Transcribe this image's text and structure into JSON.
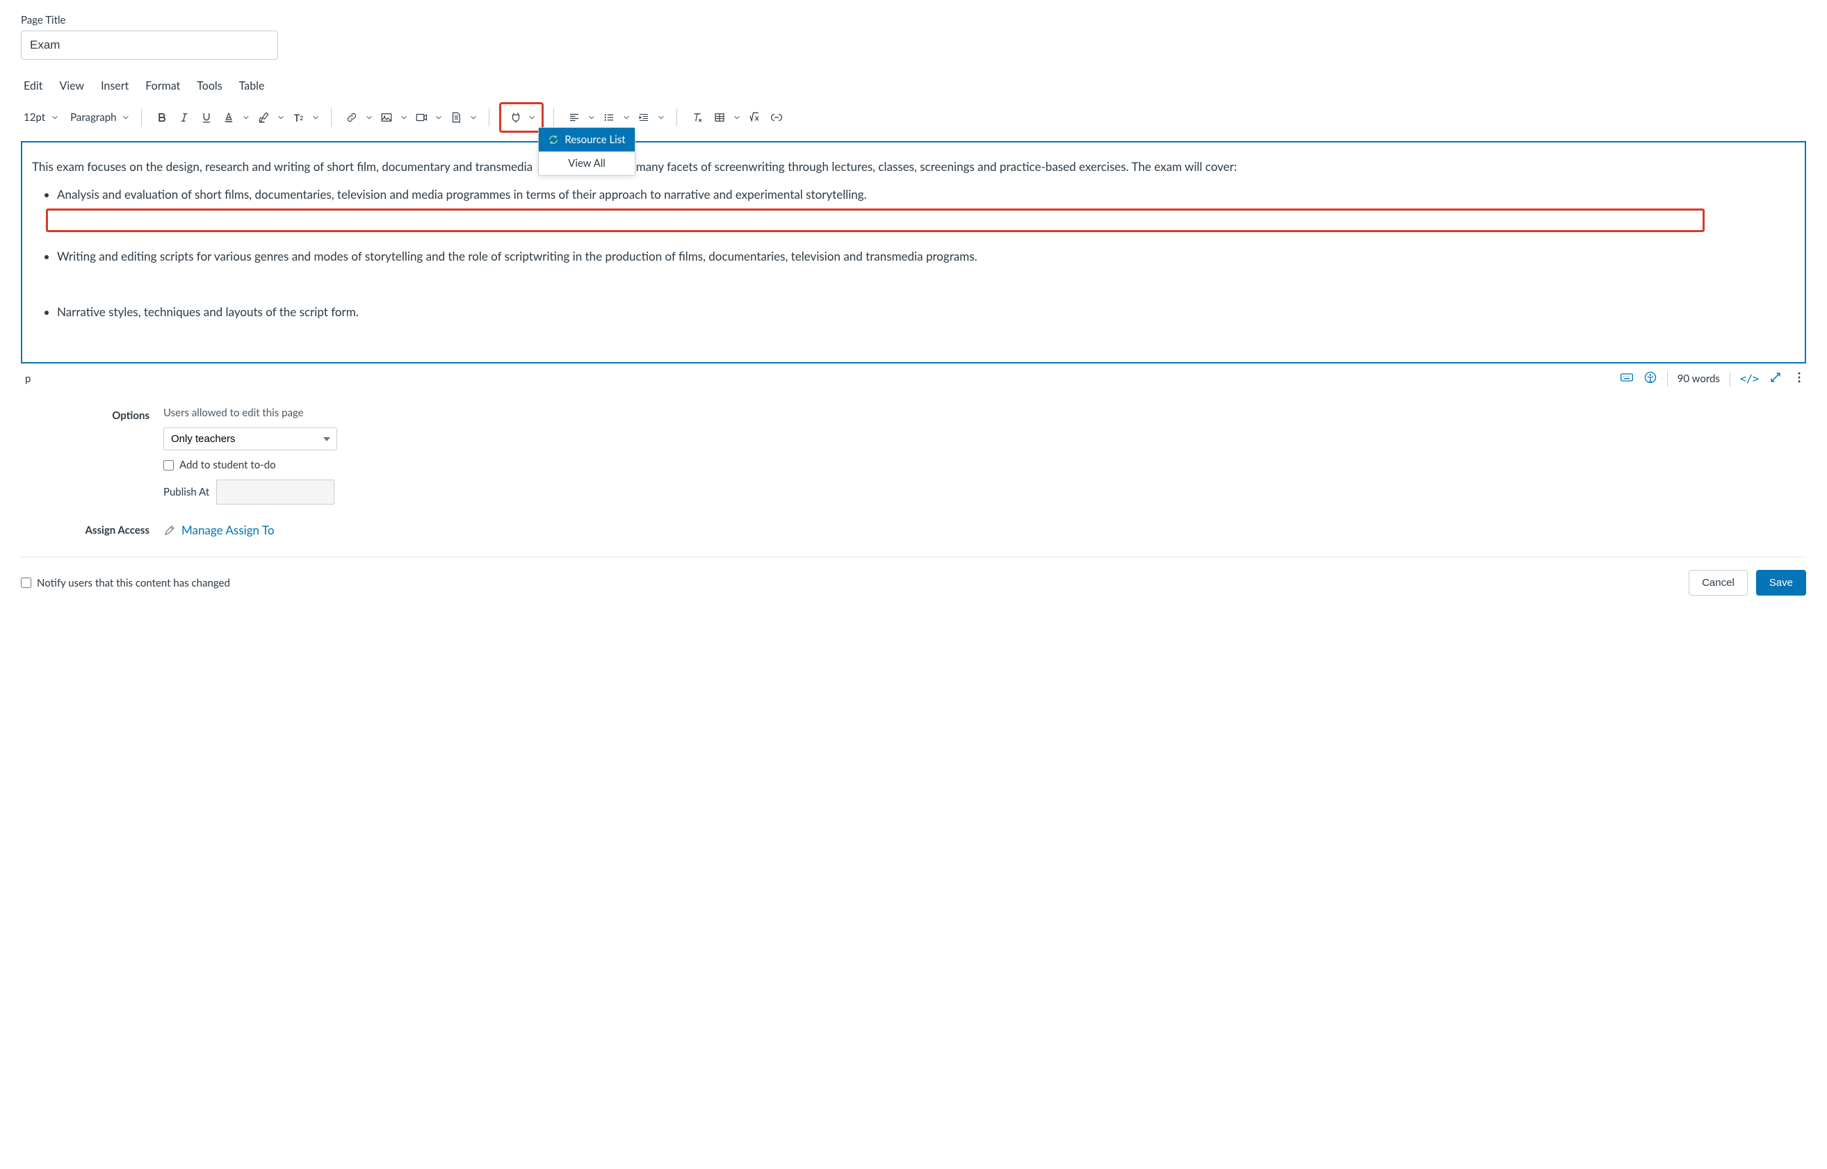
{
  "pageTitleLabel": "Page Title",
  "pageTitleValue": "Exam",
  "menubar": {
    "edit": "Edit",
    "view": "View",
    "insert": "Insert",
    "format": "Format",
    "tools": "Tools",
    "table": "Table"
  },
  "toolbar": {
    "fontSize": "12pt",
    "blockFormat": "Paragraph"
  },
  "dropdown": {
    "resourceList": "Resource List",
    "viewAll": "View All"
  },
  "content": {
    "intro": "This exam focuses on the design, research and writing of short film, documentary and transmedia               udying the many facets of screenwriting through lectures, classes, screenings and practice-based exercises. The exam will cover:",
    "b1": "Analysis and evaluation of short films, documentaries, television and media programmes in terms of their approach to narrative and experimental storytelling.",
    "b2": "Writing and editing scripts for various genres and modes of storytelling and the role of scriptwriting in the production of films, documentaries, television and transmedia programs.",
    "b3": "Narrative styles, techniques and layouts of the script form."
  },
  "statusbar": {
    "path": "p",
    "wordCount": "90 words",
    "codeToggle": "</>"
  },
  "options": {
    "label": "Options",
    "usersAllowed": "Users allowed to edit this page",
    "selectValue": "Only teachers",
    "addTodo": "Add to student to-do",
    "publishAt": "Publish At"
  },
  "assign": {
    "label": "Assign Access",
    "link": "Manage Assign To"
  },
  "footer": {
    "notify": "Notify users that this content has changed",
    "cancel": "Cancel",
    "save": "Save"
  }
}
